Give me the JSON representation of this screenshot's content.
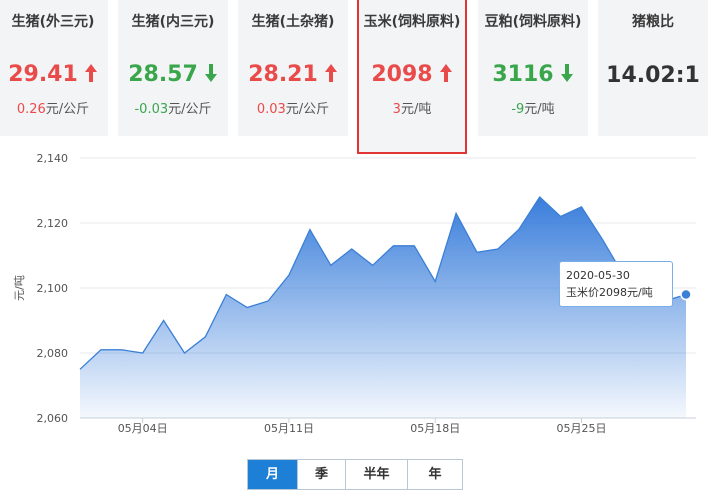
{
  "cards": [
    {
      "title": "生猪(外三元)",
      "price": "29.41",
      "direction": "up",
      "change_value": "0.26",
      "change_unit": "元/公斤"
    },
    {
      "title": "生猪(内三元)",
      "price": "28.57",
      "direction": "down",
      "change_value": "-0.03",
      "change_unit": "元/公斤"
    },
    {
      "title": "生猪(土杂猪)",
      "price": "28.21",
      "direction": "up",
      "change_value": "0.03",
      "change_unit": "元/公斤"
    },
    {
      "title": "玉米(饲料原料)",
      "price": "2098",
      "direction": "up",
      "change_value": "3",
      "change_unit": "元/吨"
    },
    {
      "title": "豆粕(饲料原料)",
      "price": "3116",
      "direction": "down",
      "change_value": "-9",
      "change_unit": "元/吨"
    },
    {
      "title": "猪粮比",
      "price": "14.02:1",
      "direction": "none",
      "change_value": "",
      "change_unit": ""
    }
  ],
  "selected_card": 3,
  "colors": {
    "up": "#e94b4b",
    "down": "#3aa64c",
    "line": "#3b7fd6",
    "selected_border": "#e13434",
    "active_tab": "#1e7fd6"
  },
  "tabs": [
    "月",
    "季",
    "半年",
    "年"
  ],
  "active_tab": 0,
  "tooltip": {
    "date": "2020-05-30",
    "text": "玉米价2098元/吨"
  },
  "chart_data": {
    "type": "area",
    "ylabel": "元/吨",
    "xlabel": "",
    "ylim": [
      2060,
      2140
    ],
    "yticks": [
      "2,060",
      "2,080",
      "2,100",
      "2,120",
      "2,140"
    ],
    "ytick_values": [
      2060,
      2080,
      2100,
      2120,
      2140
    ],
    "xtick_labels": [
      "05月04日",
      "05月11日",
      "05月18日",
      "05月25日"
    ],
    "xtick_dates": [
      "2020-05-04",
      "2020-05-11",
      "2020-05-18",
      "2020-05-25"
    ],
    "x": [
      "2020-05-01",
      "2020-05-02",
      "2020-05-03",
      "2020-05-04",
      "2020-05-05",
      "2020-05-06",
      "2020-05-07",
      "2020-05-08",
      "2020-05-09",
      "2020-05-10",
      "2020-05-11",
      "2020-05-12",
      "2020-05-13",
      "2020-05-14",
      "2020-05-15",
      "2020-05-16",
      "2020-05-17",
      "2020-05-18",
      "2020-05-19",
      "2020-05-20",
      "2020-05-21",
      "2020-05-22",
      "2020-05-23",
      "2020-05-24",
      "2020-05-25",
      "2020-05-26",
      "2020-05-27",
      "2020-05-28",
      "2020-05-29",
      "2020-05-30"
    ],
    "series": [
      {
        "values": [
          2075,
          2081,
          2081,
          2080,
          2090,
          2080,
          2085,
          2098,
          2094,
          2096,
          2104,
          2118,
          2107,
          2112,
          2107,
          2113,
          2113,
          2102,
          2123,
          2111,
          2112,
          2118,
          2128,
          2122,
          2125,
          2115,
          2104,
          2100,
          2096,
          2098
        ]
      }
    ],
    "grid": true
  }
}
